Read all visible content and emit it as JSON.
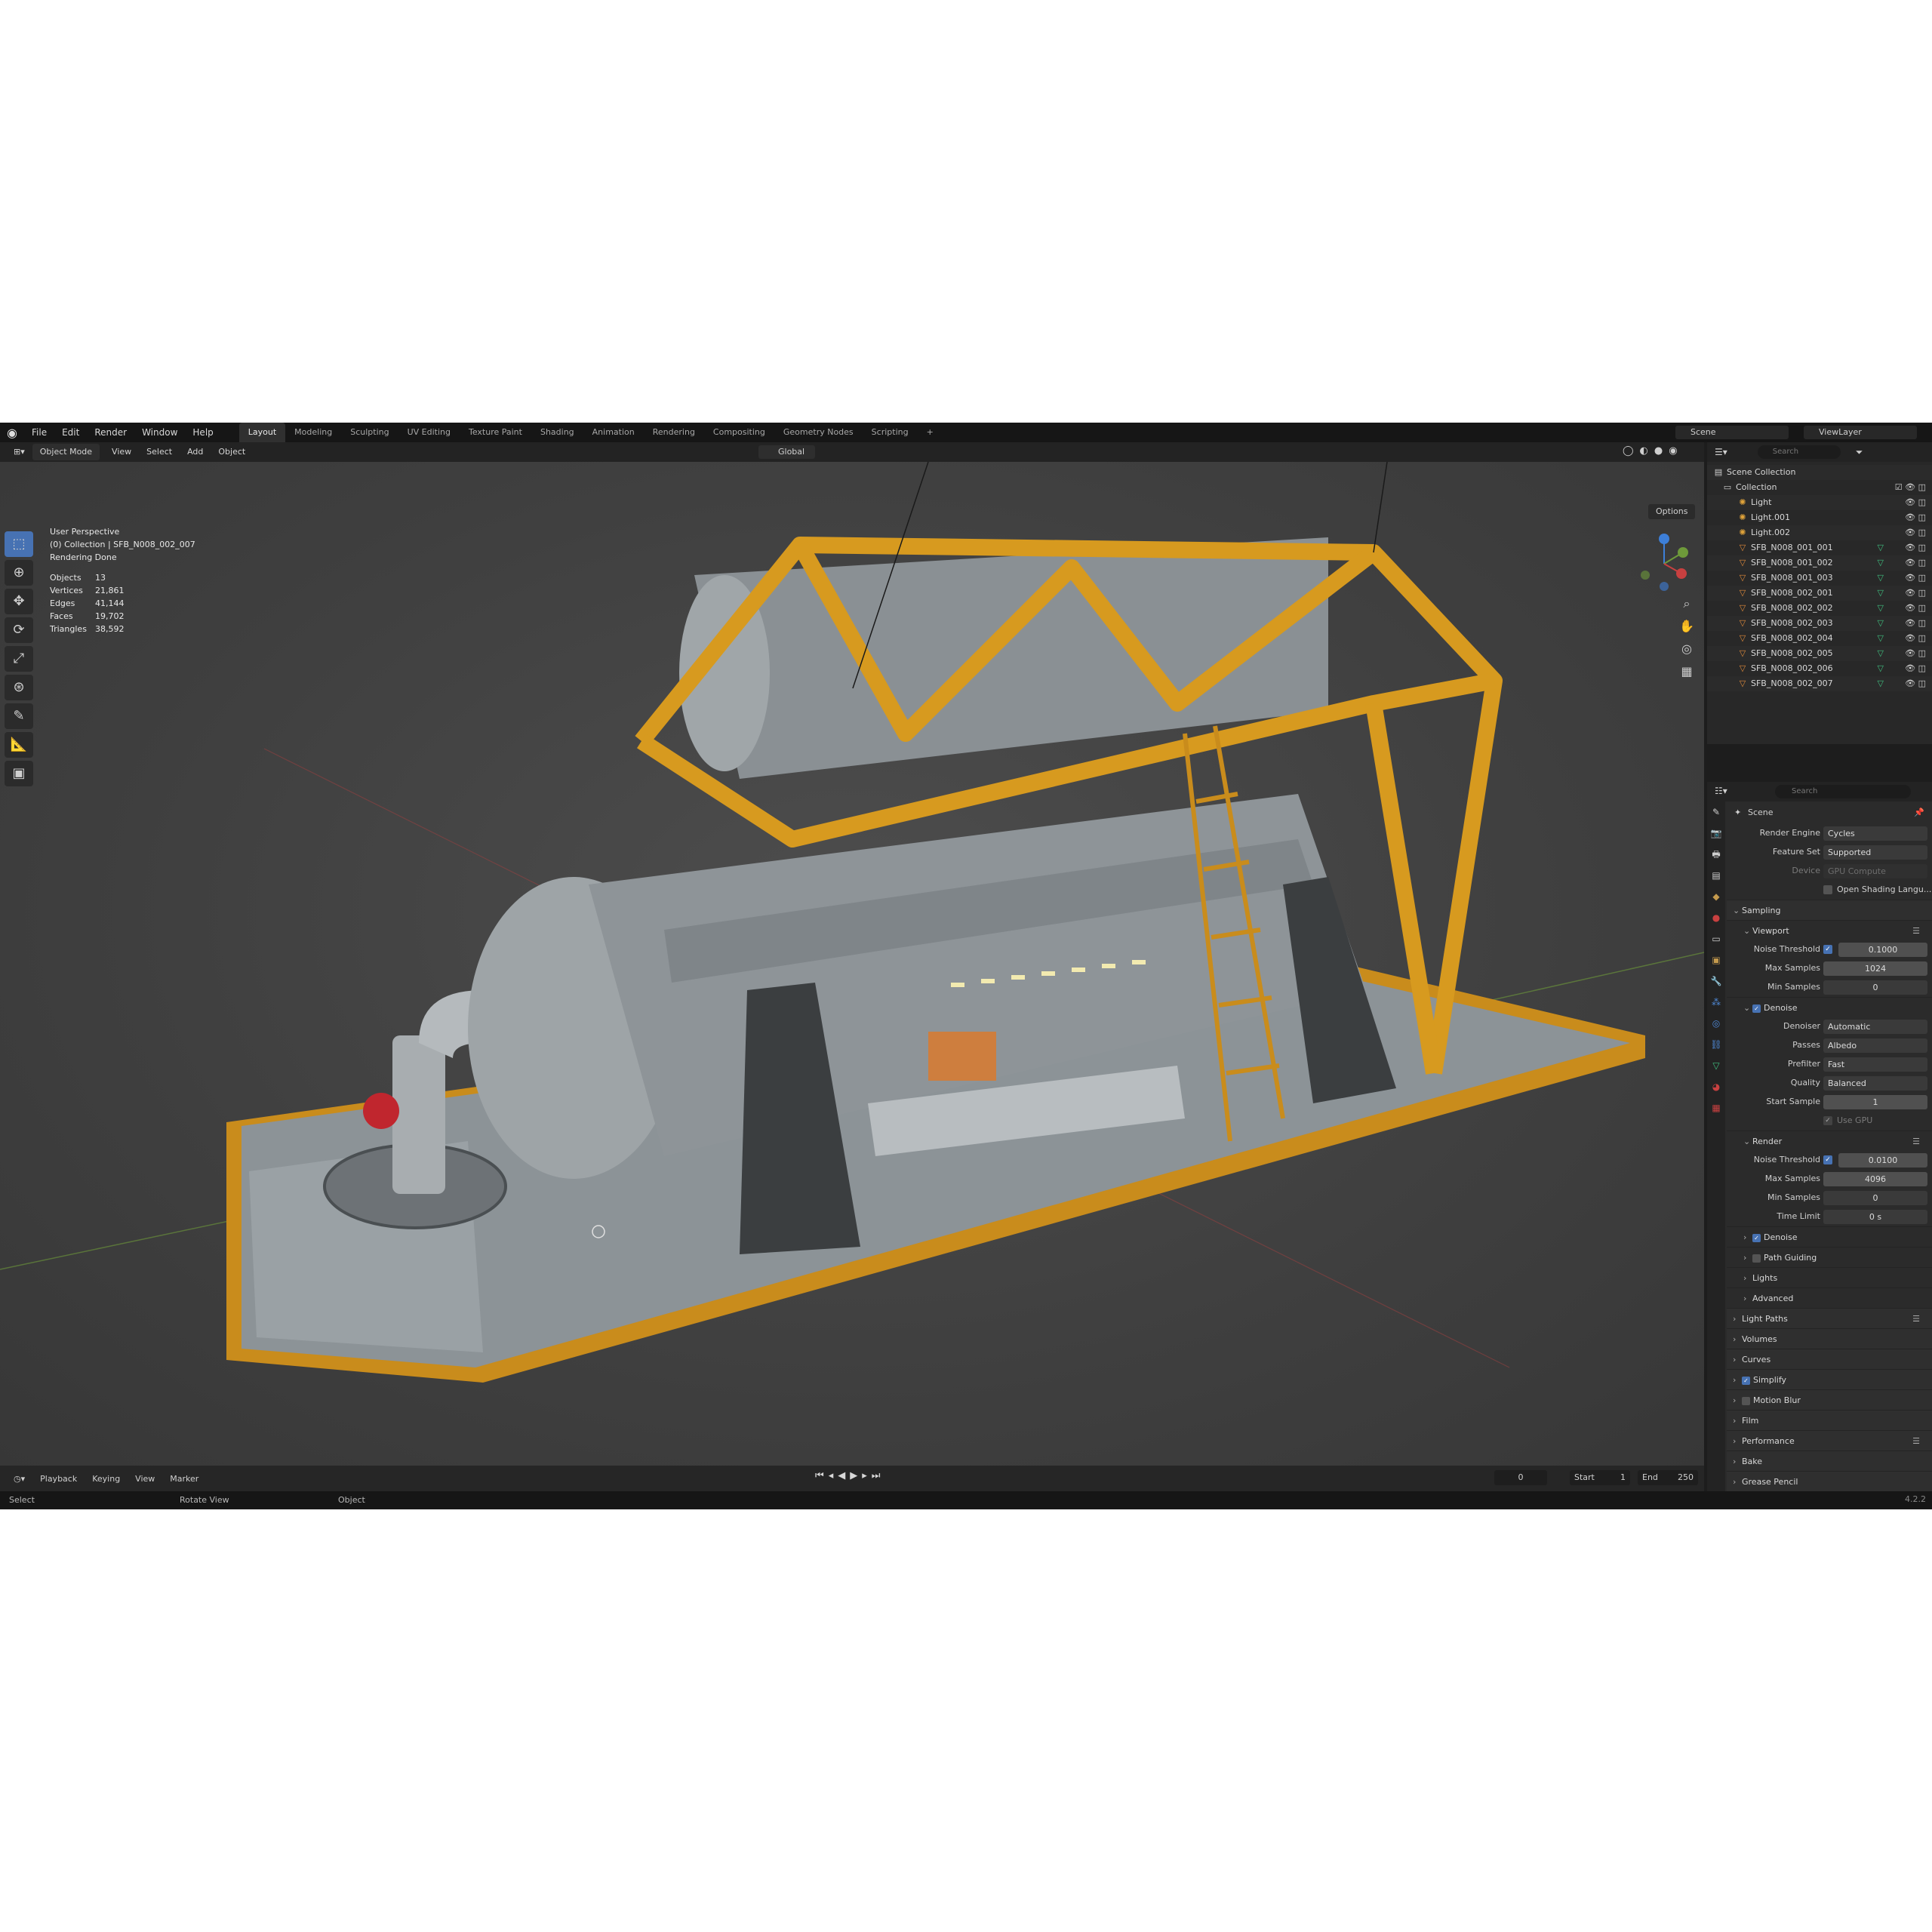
{
  "menu": [
    "File",
    "Edit",
    "Render",
    "Window",
    "Help"
  ],
  "workspaces": [
    "Layout",
    "Modeling",
    "Sculpting",
    "UV Editing",
    "Texture Paint",
    "Shading",
    "Animation",
    "Rendering",
    "Compositing",
    "Geometry Nodes",
    "Scripting"
  ],
  "active_workspace": "Layout",
  "scene_name": "Scene",
  "view_layer": "ViewLayer",
  "viewport_header": {
    "mode": "Object Mode",
    "menus": [
      "View",
      "Select",
      "Add",
      "Object"
    ],
    "orientation": "Global",
    "options": "Options"
  },
  "overlay": {
    "perspective": "User Perspective",
    "collection": "(0) Collection | SFB_N008_002_007",
    "status": "Rendering Done",
    "stats": [
      {
        "label": "Objects",
        "value": "13"
      },
      {
        "label": "Vertices",
        "value": "21,861"
      },
      {
        "label": "Edges",
        "value": "41,144"
      },
      {
        "label": "Faces",
        "value": "19,702"
      },
      {
        "label": "Triangles",
        "value": "38,592"
      }
    ]
  },
  "outliner": {
    "search_placeholder": "Search",
    "scene_collection": "Scene Collection",
    "collection": "Collection",
    "items": [
      {
        "name": "Light",
        "type": "light"
      },
      {
        "name": "Light.001",
        "type": "light"
      },
      {
        "name": "Light.002",
        "type": "light"
      },
      {
        "name": "SFB_N008_001_001",
        "type": "mesh"
      },
      {
        "name": "SFB_N008_001_002",
        "type": "mesh"
      },
      {
        "name": "SFB_N008_001_003",
        "type": "mesh"
      },
      {
        "name": "SFB_N008_002_001",
        "type": "mesh"
      },
      {
        "name": "SFB_N008_002_002",
        "type": "mesh"
      },
      {
        "name": "SFB_N008_002_003",
        "type": "mesh"
      },
      {
        "name": "SFB_N008_002_004",
        "type": "mesh"
      },
      {
        "name": "SFB_N008_002_005",
        "type": "mesh"
      },
      {
        "name": "SFB_N008_002_006",
        "type": "mesh"
      },
      {
        "name": "SFB_N008_002_007",
        "type": "mesh"
      }
    ]
  },
  "properties": {
    "search_placeholder": "Search",
    "context": "Scene",
    "render_engine_label": "Render Engine",
    "render_engine": "Cycles",
    "feature_set_label": "Feature Set",
    "feature_set": "Supported",
    "device_label": "Device",
    "device": "GPU Compute",
    "osl": "Open Shading Langu...",
    "sampling": "Sampling",
    "viewport": {
      "title": "Viewport",
      "noise_threshold_label": "Noise Threshold",
      "noise_threshold": "0.1000",
      "max_samples_label": "Max Samples",
      "max_samples": "1024",
      "min_samples_label": "Min Samples",
      "min_samples": "0",
      "denoise": "Denoise",
      "denoiser_label": "Denoiser",
      "denoiser": "Automatic",
      "passes_label": "Passes",
      "passes": "Albedo",
      "prefilter_label": "Prefilter",
      "prefilter": "Fast",
      "quality_label": "Quality",
      "quality": "Balanced",
      "start_sample_label": "Start Sample",
      "start_sample": "1",
      "use_gpu": "Use GPU"
    },
    "render": {
      "title": "Render",
      "noise_threshold_label": "Noise Threshold",
      "noise_threshold": "0.0100",
      "max_samples_label": "Max Samples",
      "max_samples": "4096",
      "min_samples_label": "Min Samples",
      "min_samples": "0",
      "time_limit_label": "Time Limit",
      "time_limit": "0 s"
    },
    "render_subpanels": [
      "Denoise",
      "Path Guiding",
      "Lights",
      "Advanced"
    ],
    "panels": [
      "Light Paths",
      "Volumes",
      "Curves",
      "Simplify",
      "Motion Blur",
      "Film",
      "Performance",
      "Bake",
      "Grease Pencil"
    ]
  },
  "timeline": {
    "menus": [
      "Playback",
      "Keying",
      "View",
      "Marker"
    ],
    "current_frame": "0",
    "start_label": "Start",
    "start": "1",
    "end_label": "End",
    "end": "250"
  },
  "statusbar": {
    "select": "Select",
    "rotate": "Rotate View",
    "object": "Object",
    "version": "4.2.2"
  },
  "colors": {
    "accent": "#4772b3",
    "frame_yellow": "#d79a1f",
    "machine_grey": "#8a9094"
  }
}
